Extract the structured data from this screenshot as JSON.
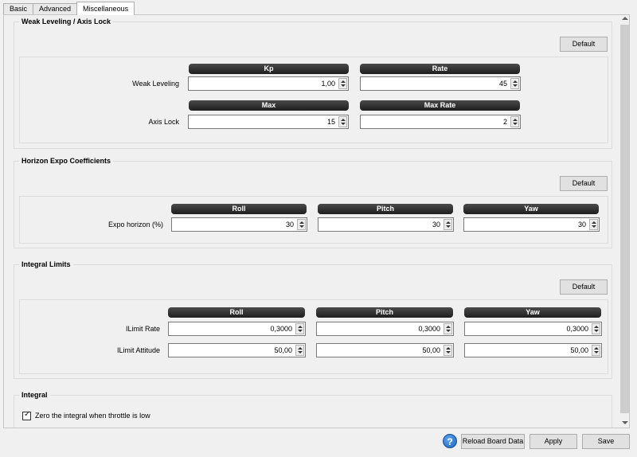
{
  "tabs": [
    {
      "label": "Basic"
    },
    {
      "label": "Advanced"
    },
    {
      "label": "Miscellaneous"
    }
  ],
  "weak_leveling": {
    "title": "Weak Leveling / Axis Lock",
    "default_label": "Default",
    "headers_row1": [
      "Kp",
      "Rate"
    ],
    "row1_label": "Weak Leveling",
    "row1_values": [
      "1,00",
      "45"
    ],
    "headers_row2": [
      "Max",
      "Max Rate"
    ],
    "row2_label": "Axis Lock",
    "row2_values": [
      "15",
      "2"
    ]
  },
  "horizon_expo": {
    "title": "Horizon Expo Coefficients",
    "default_label": "Default",
    "headers": [
      "Roll",
      "Pitch",
      "Yaw"
    ],
    "row_label": "Expo horizon (%)",
    "values": [
      "30",
      "30",
      "30"
    ]
  },
  "integral_limits": {
    "title": "Integral Limits",
    "default_label": "Default",
    "headers": [
      "Roll",
      "Pitch",
      "Yaw"
    ],
    "row1_label": "ILimit Rate",
    "row1_values": [
      "0,3000",
      "0,3000",
      "0,3000"
    ],
    "row2_label": "ILimit Attitude",
    "row2_values": [
      "50,00",
      "50,00",
      "50,00"
    ]
  },
  "integral": {
    "title": "Integral",
    "checkbox_label": "Zero the integral when throttle is low",
    "checked": true
  },
  "footer": {
    "help_icon": "?",
    "reload_label": "Reload Board Data",
    "apply_label": "Apply",
    "save_label": "Save"
  }
}
